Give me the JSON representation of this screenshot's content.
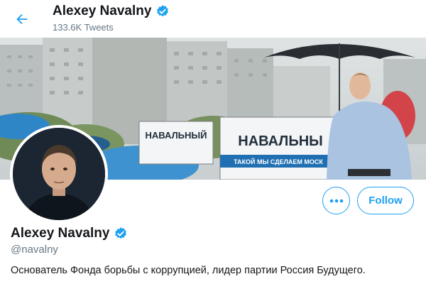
{
  "header": {
    "name": "Alexey Navalny",
    "tweet_count": "133.6K Tweets",
    "back_icon": "arrow-left-icon",
    "verified_icon": "verified-badge-icon"
  },
  "banner": {
    "sign_left": "НАВАЛЬНЫЙ",
    "sign_right": "НАВАЛЬНЫ",
    "sign_tagline": "ТАКОЙ МЫ СДЕЛАЕМ МОСК"
  },
  "actions": {
    "more_icon": "more-horizontal-icon",
    "follow_label": "Follow"
  },
  "profile": {
    "name": "Alexey Navalny",
    "handle": "@navalny",
    "bio": "Основатель Фонда борьбы с коррупцией, лидер партии Россия Будущего."
  },
  "colors": {
    "accent": "#1da1f2",
    "secondary_text": "#657786",
    "primary_text": "#14171a"
  }
}
